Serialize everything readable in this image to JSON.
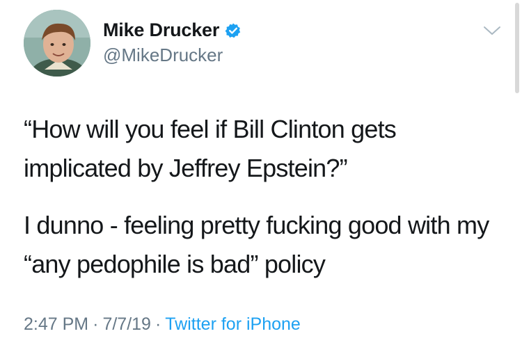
{
  "author": {
    "display_name": "Mike Drucker",
    "handle": "@MikeDrucker",
    "verified": true,
    "avatar_icon": "profile-photo"
  },
  "tweet": {
    "paragraphs": [
      "“How will you feel if Bill Clinton gets implicated by Jeffrey Epstein?”",
      "I dunno - feeling pretty fucking good with my “any pedophile is bad” policy"
    ]
  },
  "meta": {
    "time": "2:47 PM",
    "separator": "·",
    "date": "7/7/19",
    "source": "Twitter for iPhone"
  },
  "colors": {
    "text": "#14171a",
    "secondary": "#657786",
    "accent": "#1da1f2"
  }
}
